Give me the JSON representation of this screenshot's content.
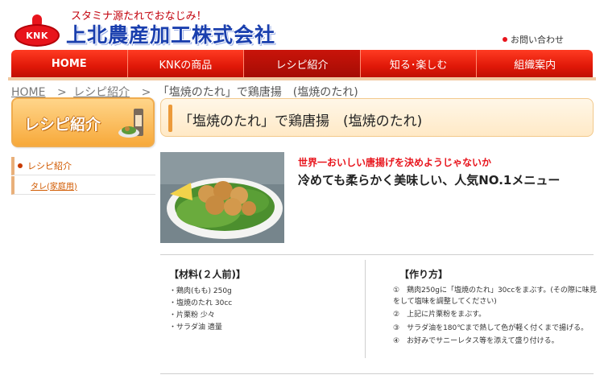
{
  "header": {
    "logo_text": "KNK",
    "tagline": "スタミナ源たれでおなじみ！",
    "company_name": "上北農産加工株式会社",
    "contact_link": "お問い合わせ"
  },
  "nav": {
    "items": [
      {
        "label": "HOME"
      },
      {
        "label": "KNKの商品"
      },
      {
        "label": "レシピ紹介"
      },
      {
        "label": "知る･楽しむ"
      },
      {
        "label": "組織案内"
      }
    ],
    "active_index": 2
  },
  "breadcrumb": {
    "home": "HOME",
    "separator": ">",
    "section": "レシピ紹介",
    "current": "「塩焼のたれ」で鶏唐揚　(塩焼のたれ)"
  },
  "sidebar": {
    "banner_title": "レシピ紹介",
    "menu": [
      {
        "label": "レシピ紹介"
      },
      {
        "label": "タレ(家庭用)"
      }
    ]
  },
  "page": {
    "heading": "「塩焼のたれ」で鶏唐揚　(塩焼のたれ)",
    "catchphrase": "世界一おいしい唐揚げを決めようじゃないか",
    "lead": "冷めても柔らかく美味しい、人気NO.1メニュー"
  },
  "ingredients": {
    "title": "【材料(２人前)】",
    "items": [
      "・鶏肉(もも) 250g",
      "・塩焼のたれ 30cc",
      "・片栗粉 少々",
      "・サラダ油 適量"
    ]
  },
  "steps": {
    "title": "【作り方】",
    "items": [
      "①　鶏肉250gに「塩焼のたれ」30ccをまぶす。(その際に味見をして塩味を調整してください)",
      "②　上記に片栗粉をまぶす。",
      "③　サラダ油を180℃まで熱して色が軽く付くまで揚げる。",
      "④　お好みでサニーレタス等を添えて盛り付ける。"
    ]
  },
  "colors": {
    "brand_red": "#e8141c",
    "brand_blue": "#1a3fae",
    "accent_orange": "#f7a93a"
  }
}
